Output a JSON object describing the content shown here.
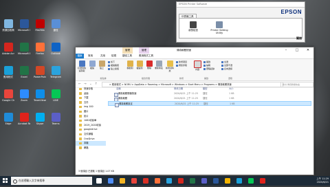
{
  "desktop": {
    "icons": [
      {
        "label": "資源回收筒",
        "color": "#7fb6e0"
      },
      {
        "label": "Microsoft Word",
        "color": "#2b579a"
      },
      {
        "label": "FileZilla",
        "color": "#bf0000"
      },
      {
        "label": "捷徑",
        "color": "#5a8fd6"
      },
      {
        "label": "Adobe Acrobat",
        "color": "#d4261e"
      },
      {
        "label": "Microsoft Excel",
        "color": "#217346"
      },
      {
        "label": "Firefox",
        "color": "#ff7139"
      },
      {
        "label": "Outlook",
        "color": "#0f63c5"
      },
      {
        "label": "應用程式",
        "color": "#1aa0d8"
      },
      {
        "label": "Excel",
        "color": "#217346"
      },
      {
        "label": "PowerPoint",
        "color": "#d24726"
      },
      {
        "label": "Telegram",
        "color": "#2aa3de"
      },
      {
        "label": "Google Chrome",
        "color": "#e8453c"
      },
      {
        "label": "Zoom",
        "color": "#2d8cff"
      },
      {
        "label": "TeamViewer",
        "color": "#0e8ee9"
      },
      {
        "label": "LINE",
        "color": "#06c755"
      },
      {
        "label": "Edge",
        "color": "#1f8bd8"
      },
      {
        "label": "Acrobat Reader",
        "color": "#e0221b"
      },
      {
        "label": "Skype",
        "color": "#00aff0"
      },
      {
        "label": "Teams",
        "color": "#5b5fc7"
      }
    ]
  },
  "epson": {
    "title": "EPSON Printer Software",
    "logo": "EPSON",
    "tab": "印表機工具",
    "buttons": [
      "狀態檢查",
      "Printer Setting Utility"
    ],
    "close": "關閉"
  },
  "explorer": {
    "context_tabs": [
      {
        "label": "管理",
        "color": "#f4dfb7"
      },
      {
        "label": "管理",
        "color": "#e8d4ee"
      }
    ],
    "title": "傳真軟體快速",
    "ribbon_tabs": [
      "檔案",
      "常用",
      "共用",
      "檢視",
      "捷徑工具",
      "應用程式工具"
    ],
    "ribbon": {
      "clipboard": {
        "pin": "釘選到快速存取",
        "copy": "複製",
        "paste": "貼上",
        "cut": "剪下",
        "copy_path": "複製路徑",
        "paste_shortcut": "貼上捷徑",
        "group": "剪貼簿"
      },
      "organize": {
        "move": "移動到",
        "copy_to": "複製到",
        "delete": "刪除",
        "rename": "重新命名",
        "group": "組合管理"
      },
      "new": {
        "folder": "新增資料夾",
        "item": "新增項目",
        "easy": "輕鬆存取",
        "group": "新增"
      },
      "open": {
        "props": "內容",
        "open": "開啟",
        "edit": "編輯",
        "history": "歷程記錄",
        "group": "開啟"
      },
      "select": {
        "all": "全選",
        "none": "全部不選",
        "invert": "反向選擇",
        "group": "選取"
      }
    },
    "address": "> 應用程式 > NORU > AppData > Roaming > Microsoft > Windows > Start Menu > Programs > 傳真軟體快速",
    "search_placeholder": "搜尋 傳真軟體快速",
    "nav_items": [
      {
        "label": "快速存取",
        "selected": false
      },
      {
        "label": "桌面",
        "selected": false
      },
      {
        "label": "下載",
        "selected": false
      },
      {
        "label": "文件",
        "selected": false
      },
      {
        "label": "img 100",
        "selected": false
      },
      {
        "label": "圖片",
        "selected": false
      },
      {
        "label": "影片",
        "selected": false
      },
      {
        "label": "1061收據單",
        "selected": false
      },
      {
        "label": "2019_2020收據",
        "selected": false
      },
      {
        "label": "googledrive",
        "selected": false
      },
      {
        "label": "文件歸檔",
        "selected": false
      },
      {
        "label": "OneDrive",
        "selected": false
      },
      {
        "label": "本機",
        "selected": true
      },
      {
        "label": "網路",
        "selected": false
      }
    ],
    "columns": [
      "名稱",
      "修改日期",
      "類型",
      "大小"
    ],
    "files": [
      {
        "name": "傳真軟體開機快速",
        "date": "2020/6/21 上午 11:25",
        "type": "捷徑",
        "size": "1 KB",
        "selected": false
      },
      {
        "name": "傳真軟體",
        "date": "2020/6/21 上午 11:25",
        "type": "捷徑",
        "size": "1 KB",
        "selected": false
      },
      {
        "name": "傳真軟體設定",
        "date": "2020/6/21 上午 11:25",
        "type": "捷徑",
        "size": "1 KB",
        "selected": true
      }
    ],
    "status": "3 個項目  已選取 1 個項目 1.07 KB"
  },
  "taskbar": {
    "search_placeholder": "在這裡輸入文字來搜尋",
    "apps": [
      "#ffffff",
      "#4f8ef7",
      "#f3b322",
      "#e8453c",
      "#d93025",
      "#ff7139",
      "#2aa3de",
      "#d4261e",
      "#217346",
      "#5b5fc7",
      "#2b579a",
      "#f4b400",
      "#1aa0d8",
      "#06c755",
      "#e0221b"
    ],
    "time": "上午 11:29",
    "date": "2020/6/21"
  }
}
